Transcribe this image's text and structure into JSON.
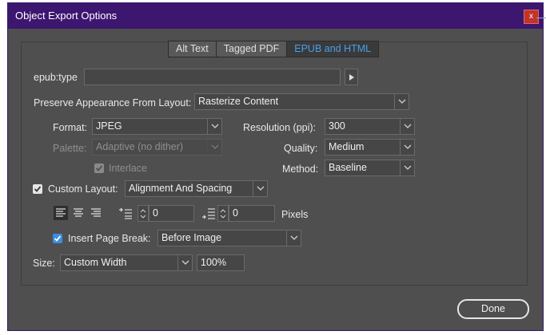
{
  "window": {
    "title": "Object Export Options",
    "close_glyph": "x"
  },
  "tabs": [
    {
      "label": "Alt Text",
      "active": false
    },
    {
      "label": "Tagged PDF",
      "active": false
    },
    {
      "label": "EPUB and HTML",
      "active": true
    }
  ],
  "epub_type": {
    "label": "epub:type",
    "value": "",
    "button_icon": "play-right-icon"
  },
  "preserve": {
    "label": "Preserve Appearance From Layout:",
    "value": "Rasterize Content"
  },
  "format": {
    "label": "Format:",
    "value": "JPEG"
  },
  "palette": {
    "label": "Palette:",
    "value": "Adaptive (no dither)",
    "disabled": true
  },
  "interlace": {
    "label": "Interlace",
    "checked": true,
    "disabled": true
  },
  "resolution": {
    "label": "Resolution (ppi):",
    "value": "300"
  },
  "quality": {
    "label": "Quality:",
    "value": "Medium"
  },
  "method": {
    "label": "Method:",
    "value": "Baseline"
  },
  "custom_layout": {
    "label": "Custom Layout:",
    "checked": true,
    "value": "Alignment And Spacing"
  },
  "alignment": {
    "options": [
      "align-left-icon",
      "align-center-icon",
      "align-right-icon"
    ],
    "selected": "align-left-icon"
  },
  "space_before": {
    "value": "0",
    "icon": "space-before-icon"
  },
  "space_after": {
    "value": "0",
    "icon": "space-after-icon"
  },
  "units_label": "Pixels",
  "page_break": {
    "label": "Insert Page Break:",
    "checked": true,
    "value": "Before Image"
  },
  "size": {
    "label": "Size:",
    "value": "Custom Width",
    "percent": "100%"
  },
  "done_button": "Done",
  "colors": {
    "titlebar": "#3d1670",
    "accent": "#4a9fe8",
    "checkbox_blue": "#3b8ee0",
    "close": "#c0342c"
  }
}
